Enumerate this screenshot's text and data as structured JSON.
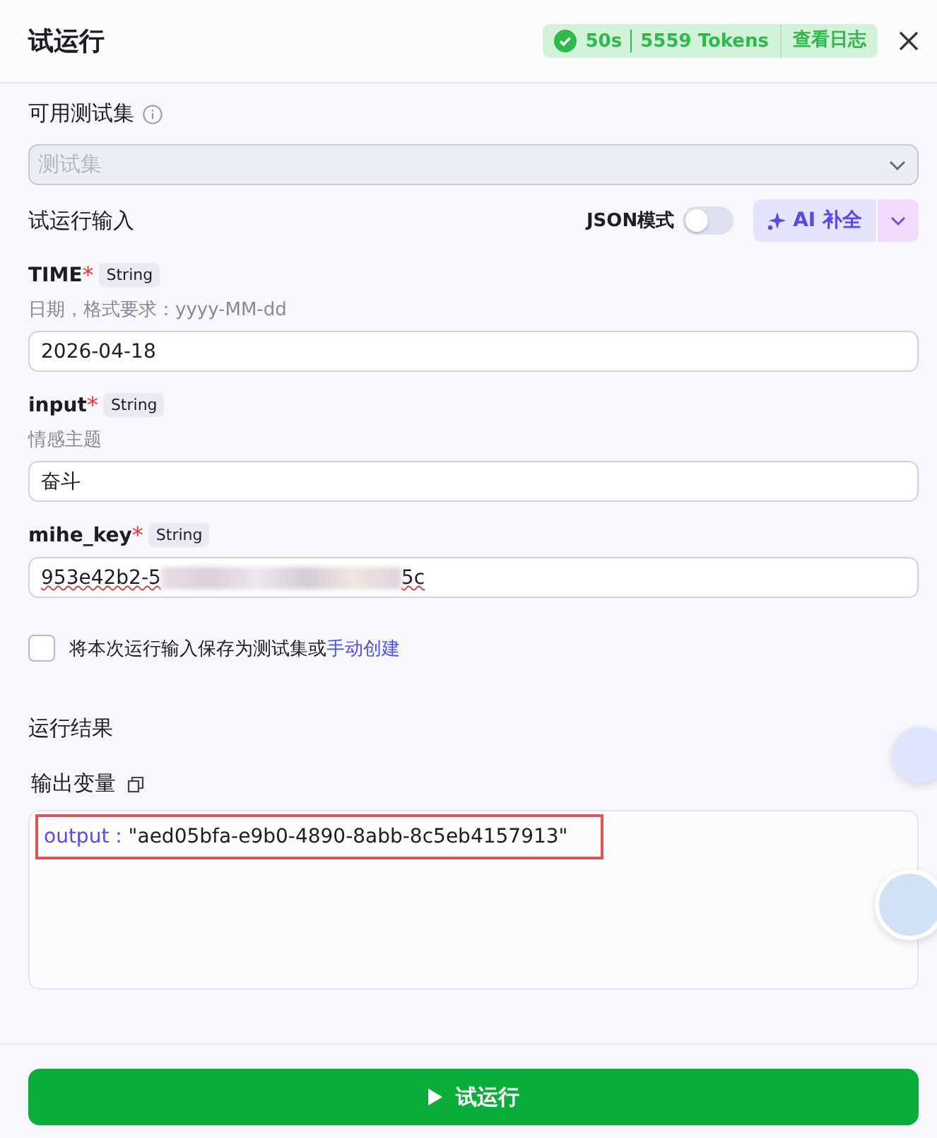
{
  "window": {
    "title": "试运行"
  },
  "run_status": {
    "ok": true,
    "duration": "50s",
    "tokens": "5559 Tokens",
    "log_link": "查看日志"
  },
  "test_set": {
    "label": "可用测试集",
    "placeholder": "测试集"
  },
  "input_section": {
    "title": "试运行输入",
    "json_mode_label": "JSON模式",
    "json_mode": false,
    "ai_button": "AI 补全"
  },
  "fields": [
    {
      "name": "TIME",
      "required_mark": "*",
      "type": "String",
      "hint": "日期，格式要求：yyyy-MM-dd",
      "value": "2026-04-18"
    },
    {
      "name": "input",
      "required_mark": "*",
      "type": "String",
      "hint": "情感主题",
      "value": "奋斗"
    },
    {
      "name": "mihe_key",
      "required_mark": "*",
      "type": "String",
      "value": "953e42b2-5",
      "value_end": "5c",
      "blurred": true,
      "misspelled": true
    }
  ],
  "save_option": {
    "checked": false,
    "text": "将本次运行输入保存为测试集或",
    "link": "手动创建"
  },
  "result": {
    "title": "运行结果",
    "variables_label": "输出变量",
    "outputs": [
      {
        "key": "output",
        "separator": " : ",
        "value": "\"aed05bfa-e9b0-4890-8abb-8c5eb4157913\"",
        "highlighted": true
      }
    ]
  },
  "run_button": {
    "label": "试运行"
  }
}
